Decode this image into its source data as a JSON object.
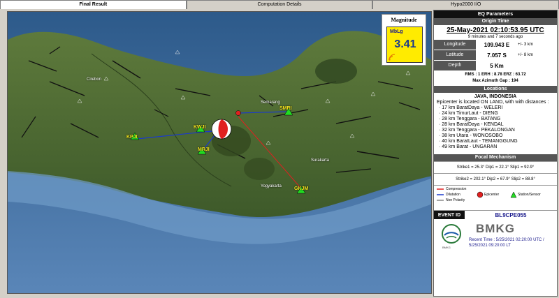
{
  "tabs": [
    {
      "label": "Final Result",
      "active": true
    },
    {
      "label": "Computation Details",
      "active": false
    },
    {
      "label": "Hypo2000 I/O",
      "active": false
    }
  ],
  "map": {
    "place_labels": [
      "Cirebon",
      "Semarang",
      "Surakarta",
      "Yogyakarta"
    ],
    "stations": [
      "KPJI",
      "SMRI",
      "KWJI",
      "MRJI",
      "GKJM"
    ]
  },
  "magnitude": {
    "title": "Magnitude",
    "type": "MbLg",
    "value": "3.41",
    "color": "#ffeb00"
  },
  "panel": {
    "title": "EQ Parameters",
    "origin_time_label": "Origin Time",
    "origin_time": "25-May-2021 02:10:53.95 UTC",
    "ago": "9 minutes and 7 seconds  ago",
    "longitude_label": "Longitude",
    "longitude": "109.943 E",
    "longitude_unc": "+/- 3 km",
    "latitude_label": "Latitude",
    "latitude": "7.057 S",
    "latitude_unc": "+/- 8 km",
    "depth_label": "Depth",
    "depth": "5 Km",
    "stats_line1": "RMS : 1   ERH : 8.78   ERZ : 63.72",
    "stats_line2": "Max Azimuth Gap : 194",
    "locations_label": "Locations",
    "region": "JAVA, INDONESIA",
    "epicenter_text": "Epicenter is located ON LAND, with with distances :",
    "distances": [
      "17 km BaratDaya - WELERI",
      "24 km TimurLaut - DIENG",
      "28 km Tenggara - BATANG",
      "28 km BaratDaya - KENDAL",
      "32 km Tenggara - PEKALONGAN",
      "38 km Utara - WONOSOBO",
      "40 km BaratLaut - TEMANGGUNG",
      "49 km Barat - UNGARAN"
    ],
    "focal_label": "Focal Mechanism",
    "focal_line1": "Strike1 = 25.3°  Dip1 = 22.1°  Slip1 = 92.9°",
    "focal_line2": "Strike2 = 202.1°  Dip2 = 67.9°  Slip2 = 88.8°",
    "legend": {
      "compression": "Compression",
      "dilatation": "Dilatation",
      "non_polarity": "Non Polarity",
      "epicenter": "Epicenter",
      "station": "Station/Sensor",
      "compression_color": "#e02020",
      "dilatation_color": "#1a3acc"
    },
    "event_id_label": "EVENT ID",
    "event_id": "BL9CPE055",
    "brand": "BMKG",
    "logo_text": "BMKG",
    "recent_line1": "Recent Time : 5/25/2021 02:20:00 UTC /",
    "recent_line2": "5/25/2021 09:20:00 LT"
  }
}
